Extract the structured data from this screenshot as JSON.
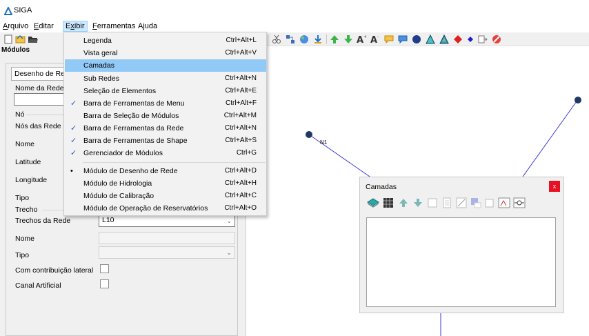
{
  "app": {
    "title": "SIGA"
  },
  "menubar": {
    "items": [
      {
        "label": "Arquivo",
        "ul": "A",
        "rest": "rquivo"
      },
      {
        "label": "Editar",
        "ul": "E",
        "rest": "ditar"
      },
      {
        "label": "Exibir",
        "ul": "x",
        "pre": "E",
        "rest": "ibir"
      },
      {
        "label": "Ferramentas",
        "ul": "F",
        "rest": "erramentas"
      },
      {
        "label": "Ajuda",
        "ul": "",
        "rest": "Ajuda"
      }
    ]
  },
  "modules": {
    "header": "Módulos",
    "tab": "Desenho de Rede",
    "nome_rede_label": "Nome da Rede",
    "no_group": "Nó",
    "nos_da_rede": "Nós das Rede",
    "nome": "Nome",
    "latitude": "Latitude",
    "longitude": "Longitude",
    "tipo": "Tipo",
    "trecho_group": "Trecho",
    "trechos_da_rede": "Trechos da Rede",
    "trechos_value": "L10",
    "trecho_nome": "Nome",
    "trecho_tipo": "Tipo",
    "contribuicao": "Com contribuição lateral",
    "canal": "Canal Artificial"
  },
  "exibir_menu": {
    "items": [
      {
        "label": "Legenda",
        "shortcut": "Ctrl+Alt+L",
        "mark": ""
      },
      {
        "label": "Vista geral",
        "shortcut": "Ctrl+Alt+V",
        "mark": ""
      },
      {
        "label": "Camadas",
        "shortcut": "",
        "mark": "",
        "highlight": true
      },
      {
        "label": "Sub Redes",
        "shortcut": "Ctrl+Alt+N",
        "mark": ""
      },
      {
        "label": "Seleção de Elementos",
        "shortcut": "Ctrl+Alt+E",
        "mark": ""
      },
      {
        "label": "Barra de Ferramentas de Menu",
        "shortcut": "Ctrl+Alt+F",
        "mark": "✓"
      },
      {
        "label": "Barra de Seleção de Módulos",
        "shortcut": "Ctrl+Alt+M",
        "mark": ""
      },
      {
        "label": "Barra de Ferramentas da Rede",
        "shortcut": "Ctrl+Alt+N",
        "mark": "✓"
      },
      {
        "label": "Barra de Ferramentas de Shape",
        "shortcut": "Ctrl+Alt+S",
        "mark": "✓"
      },
      {
        "label": "Gerenciador de Módulos",
        "shortcut": "Ctrl+G",
        "mark": "✓"
      },
      {
        "label": "Módulo de Desenho de Rede",
        "shortcut": "Ctrl+Alt+D",
        "mark": "•"
      },
      {
        "label": "Módulo de Hidrologia",
        "shortcut": "Ctrl+Alt+H",
        "mark": ""
      },
      {
        "label": "Módulo de Calibração",
        "shortcut": "Ctrl+Alt+C",
        "mark": ""
      },
      {
        "label": "Módulo de Operação de Reservatórios",
        "shortcut": "Ctrl+Alt+O",
        "mark": ""
      }
    ]
  },
  "canvas": {
    "node_label": "N1"
  },
  "camadas": {
    "title": "Camadas",
    "close": "x"
  },
  "colors": {
    "accent": "#0078d7",
    "highlight": "#91c9f7",
    "close": "#e81123",
    "node": "#1f3864"
  }
}
